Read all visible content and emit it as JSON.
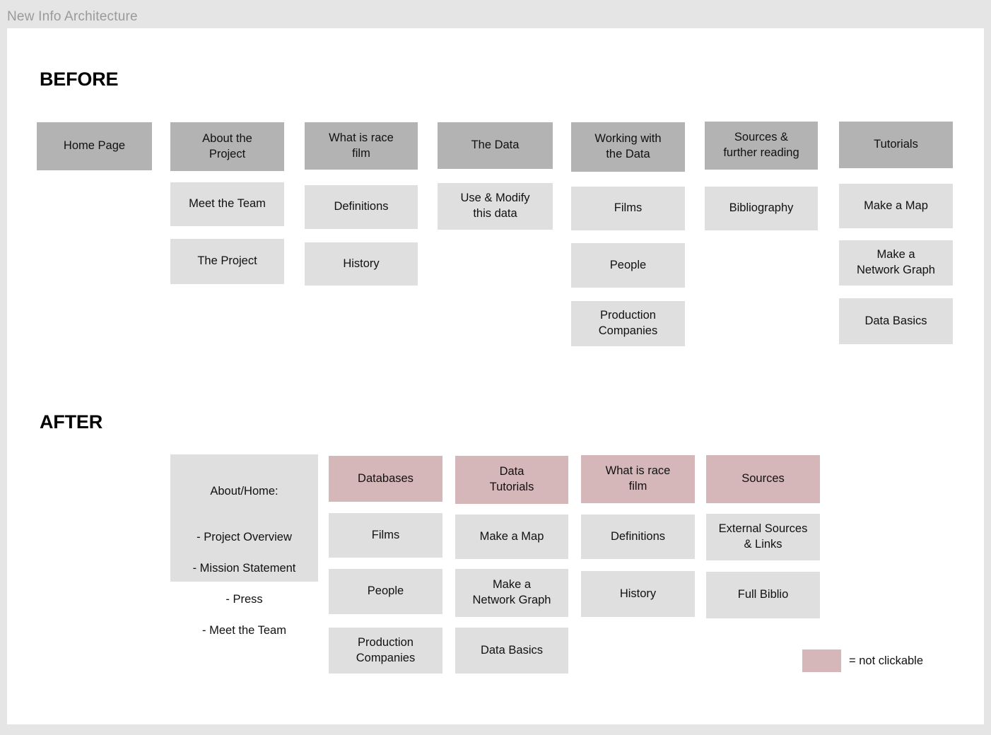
{
  "board": {
    "title": "New Info Architecture",
    "colors": {
      "background": "#e5e5e5",
      "canvas": "#ffffff",
      "top_node": "#b3b3b3",
      "sub_node": "#dfdfdf",
      "not_clickable": "#d6b7b9"
    }
  },
  "before": {
    "heading": "BEFORE",
    "columns": [
      {
        "top": "Home Page",
        "children": []
      },
      {
        "top": "About the\nProject",
        "children": [
          "Meet the Team",
          "The Project"
        ]
      },
      {
        "top": "What is race\nfilm",
        "children": [
          "Definitions",
          "History"
        ]
      },
      {
        "top": "The Data",
        "children": [
          "Use & Modify\nthis data"
        ]
      },
      {
        "top": "Working with\nthe Data",
        "children": [
          "Films",
          "People",
          "Production\nCompanies"
        ]
      },
      {
        "top": "Sources &\nfurther reading",
        "children": [
          "Bibliography"
        ]
      },
      {
        "top": "Tutorials",
        "children": [
          "Make a Map",
          "Make a\nNetwork Graph",
          "Data Basics"
        ]
      }
    ]
  },
  "after": {
    "heading": "AFTER",
    "about_block": {
      "title": "About/Home:",
      "lines": [
        "- Project Overview",
        "- Mission Statement",
        "- Press",
        "- Meet the Team"
      ]
    },
    "columns": [
      {
        "top": "Databases",
        "top_clickable": false,
        "children": [
          "Films",
          "People",
          "Production\nCompanies"
        ]
      },
      {
        "top": "Data\nTutorials",
        "top_clickable": false,
        "children": [
          "Make a Map",
          "Make a\nNetwork Graph",
          "Data Basics"
        ]
      },
      {
        "top": "What is race\nfilm",
        "top_clickable": false,
        "children": [
          "Definitions",
          "History"
        ]
      },
      {
        "top": "Sources",
        "top_clickable": false,
        "children": [
          "External Sources\n& Links",
          "Full Biblio"
        ]
      }
    ],
    "legend": {
      "label": "= not clickable"
    }
  }
}
